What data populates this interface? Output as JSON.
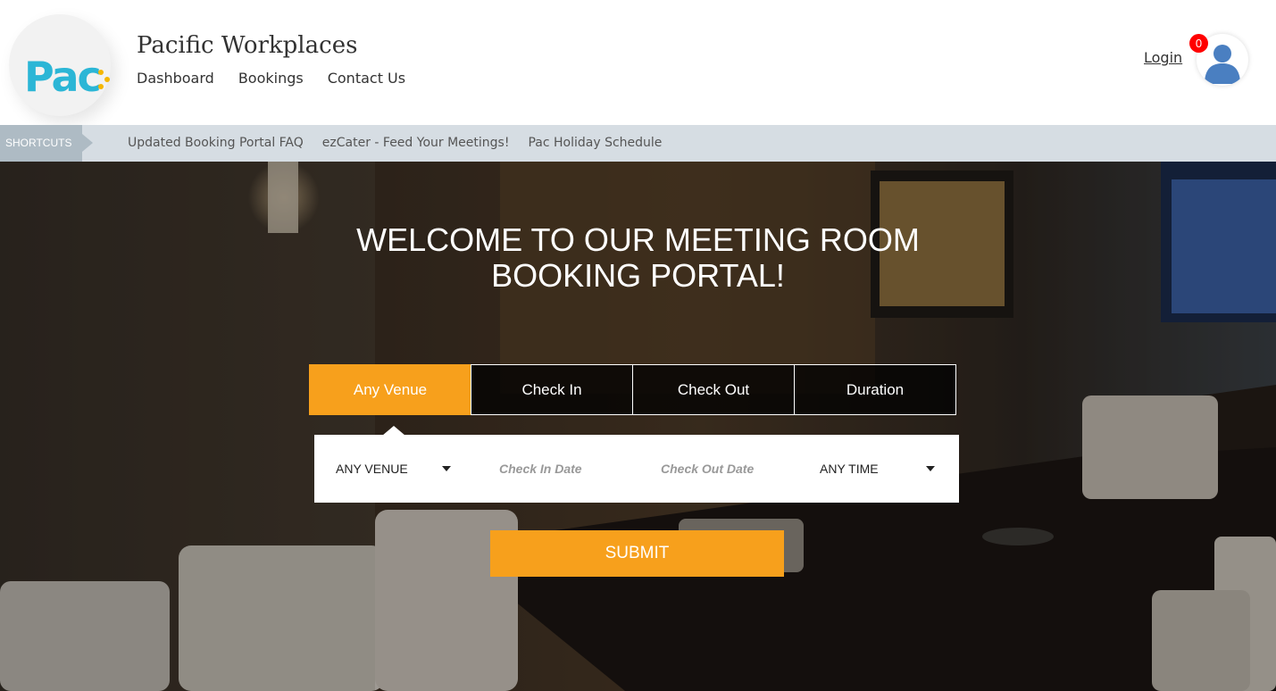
{
  "header": {
    "logo_text": "Pac",
    "brand": "Pacific Workplaces",
    "nav": [
      "Dashboard",
      "Bookings",
      "Contact Us"
    ],
    "login_label": "Login",
    "cart_count": "0"
  },
  "shortcuts": {
    "label": "SHORTCUTS",
    "links": [
      "Updated Booking Portal FAQ",
      "ezCater - Feed Your Meetings!",
      "Pac Holiday Schedule"
    ]
  },
  "hero": {
    "title_line1": "WELCOME TO OUR MEETING ROOM",
    "title_line2": "BOOKING PORTAL!",
    "tabs": [
      "Any Venue",
      "Check In",
      "Check Out",
      "Duration"
    ],
    "active_tab": "Any Venue",
    "venue_select": "ANY VENUE",
    "checkin_placeholder": "Check In Date",
    "checkout_placeholder": "Check Out Date",
    "time_select": "ANY TIME",
    "submit_label": "SUBMIT"
  },
  "colors": {
    "accent": "#f7a01c",
    "logo_blue": "#2bb6d6",
    "logo_yellow": "#f5b700",
    "badge_red": "#ff0000",
    "shortcut_bar": "#d6dde3"
  },
  "icons": [
    "user-avatar-icon",
    "caret-down-icon"
  ]
}
